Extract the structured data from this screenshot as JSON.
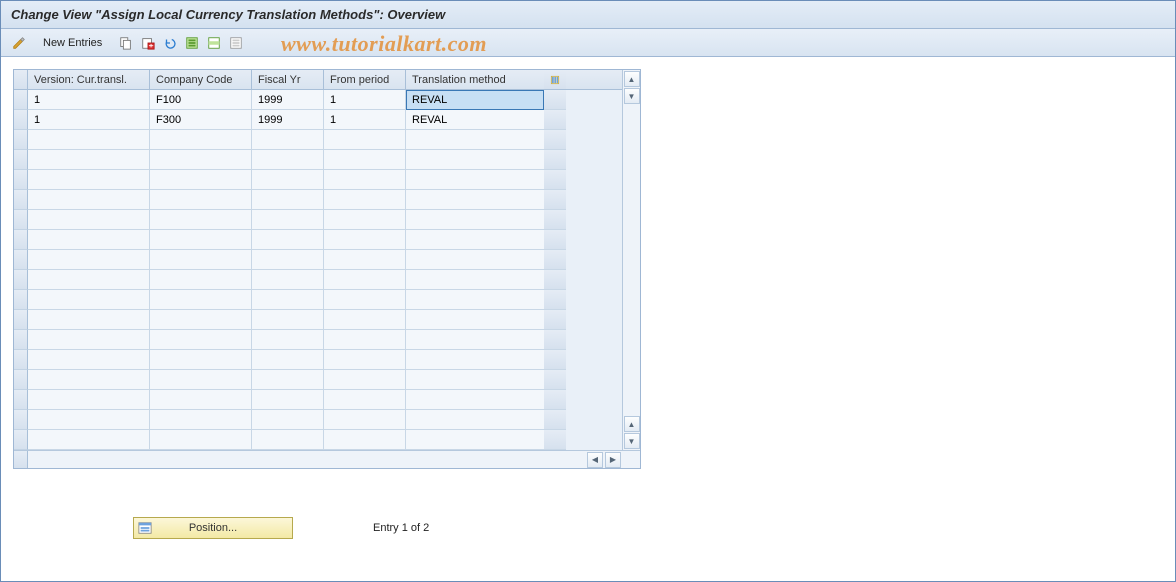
{
  "title": "Change View \"Assign Local Currency Translation Methods\": Overview",
  "toolbar": {
    "new_entries_label": "New Entries"
  },
  "watermark": "www.tutorialkart.com",
  "table": {
    "headers": {
      "version": "Version: Cur.transl.",
      "company": "Company Code",
      "fiscal": "Fiscal Yr",
      "period": "From period",
      "method": "Translation method"
    },
    "rows": [
      {
        "version": "1",
        "company": "F100",
        "fiscal": "1999",
        "period": "1",
        "method": "REVAL"
      },
      {
        "version": "1",
        "company": "F300",
        "fiscal": "1999",
        "period": "1",
        "method": "REVAL"
      }
    ],
    "empty_row_count": 16
  },
  "footer": {
    "position_label": "Position...",
    "entry_text": "Entry 1 of 2"
  }
}
